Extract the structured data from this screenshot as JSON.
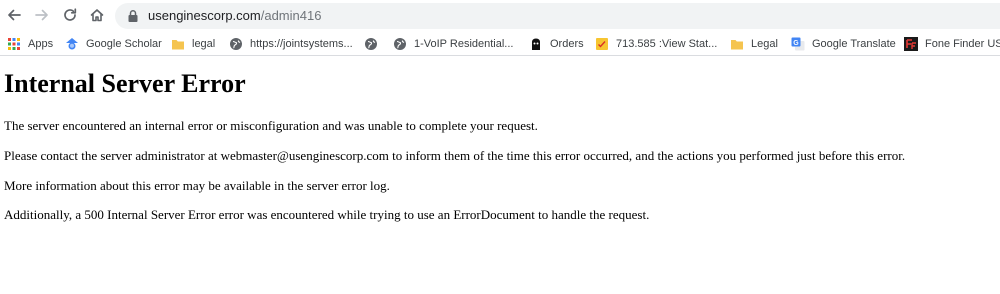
{
  "browser": {
    "url_host": "usenginescorp.com",
    "url_path": "/admin416"
  },
  "bookmarks": [
    {
      "label": "Apps",
      "icon": "apps-grid-icon"
    },
    {
      "label": "Google Scholar",
      "icon": "google-scholar-icon"
    },
    {
      "label": "legal",
      "icon": "folder-icon"
    },
    {
      "label": "https://jointsystems...",
      "icon": "globe-icon"
    },
    {
      "label": "",
      "icon": "globe-icon"
    },
    {
      "label": "1-VoIP Residential...",
      "icon": "globe-icon"
    },
    {
      "label": "Orders",
      "icon": "orders-icon"
    },
    {
      "label": "713.585 :View Stat...",
      "icon": "sticky-note-icon"
    },
    {
      "label": "Legal",
      "icon": "folder-icon"
    },
    {
      "label": "Google Translate",
      "icon": "google-translate-icon"
    },
    {
      "label": "Fone Finder USA",
      "icon": "fone-finder-icon"
    }
  ],
  "page": {
    "title": "Internal Server Error",
    "paragraphs": [
      "The server encountered an internal error or misconfiguration and was unable to complete your request.",
      "Please contact the server administrator at webmaster@usenginescorp.com to inform them of the time this error occurred, and the actions you performed just before this error.",
      "More information about this error may be available in the server error log.",
      "Additionally, a 500 Internal Server Error error was encountered while trying to use an ErrorDocument to handle the request."
    ]
  },
  "colors": {
    "omnibox_bg": "#f1f3f4",
    "folder": "#f5c44f",
    "google_blue": "#4285f4",
    "icon_gray": "#5f6368"
  }
}
